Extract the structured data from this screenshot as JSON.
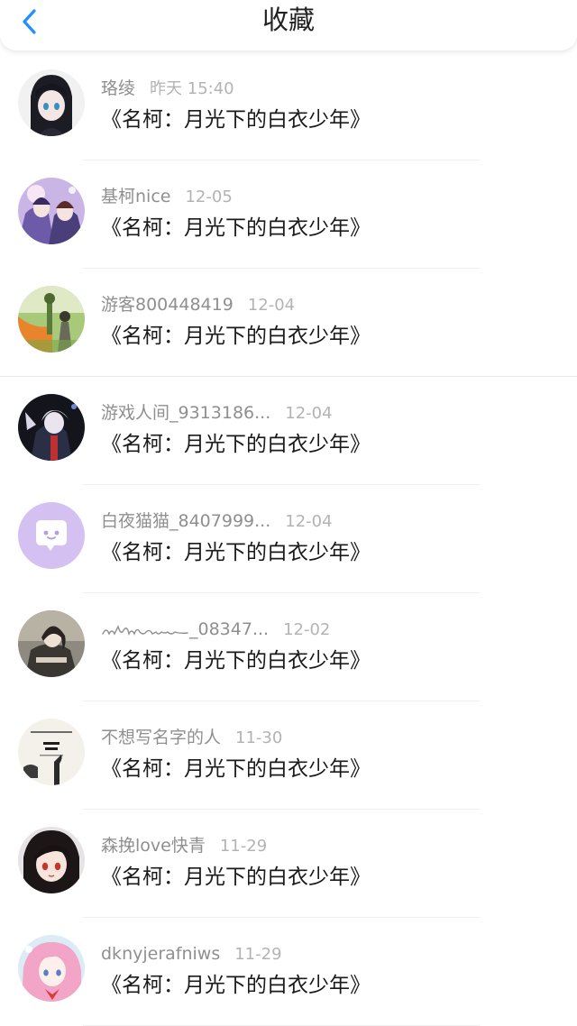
{
  "header": {
    "title": "收藏",
    "back_icon": "chevron-left-icon",
    "accent_color": "#1e90ff"
  },
  "favorites": [
    {
      "user": "珞绫",
      "time": "昨天 15:40",
      "title": "《名柯：月光下的白衣少年》",
      "avatar": "anime-girl-dark-hair-avatar"
    },
    {
      "user": "基柯nice",
      "time": "12-05",
      "title": "《名柯：月光下的白衣少年》",
      "avatar": "anime-couple-avatar"
    },
    {
      "user": "游客800448419",
      "time": "12-04",
      "title": "《名柯：月光下的白衣少年》",
      "avatar": "scenery-girl-avatar"
    },
    {
      "user": "游戏人间_9313186...",
      "time": "12-04",
      "title": "《名柯：月光下的白衣少年》",
      "avatar": "anime-boy-white-hair-avatar"
    },
    {
      "user": "白夜猫猫_8407999...",
      "time": "12-04",
      "title": "《名柯：月光下的白衣少年》",
      "avatar": "default-chat-bubble-avatar"
    },
    {
      "user": "_08347...",
      "time": "12-02",
      "title": "《名柯：月光下的白衣少年》",
      "avatar": "anime-girl-sitting-avatar",
      "signature_name": true
    },
    {
      "user": "不想写名字的人",
      "time": "11-30",
      "title": "《名柯：月光下的白衣少年》",
      "avatar": "text-poster-avatar"
    },
    {
      "user": "森挽love快青",
      "time": "11-29",
      "title": "《名柯：月光下的白衣少年》",
      "avatar": "anime-girl-red-eyes-avatar"
    },
    {
      "user": "dknyjerafniws",
      "time": "11-29",
      "title": "《名柯：月光下的白衣少年》",
      "avatar": "anime-pink-hair-girl-avatar"
    }
  ]
}
